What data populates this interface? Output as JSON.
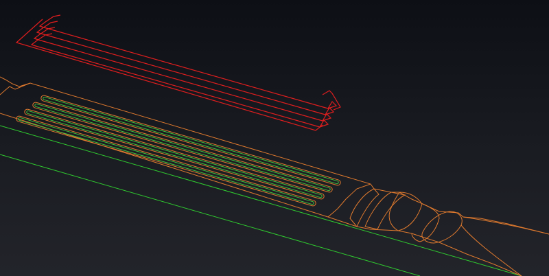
{
  "viewport": {
    "name": "cam-3d-viewport",
    "background_top": "#0d0f15",
    "background_bottom": "#23242a"
  },
  "colors": {
    "toolpath": "#e01e1e",
    "part_outline": "#e07a2e",
    "slot_pocket": "#3fc23f",
    "reference_line": "#2fcc2f"
  },
  "layers": {
    "toolpaths": {
      "passes": 4
    },
    "slots": {
      "count": 4
    }
  }
}
